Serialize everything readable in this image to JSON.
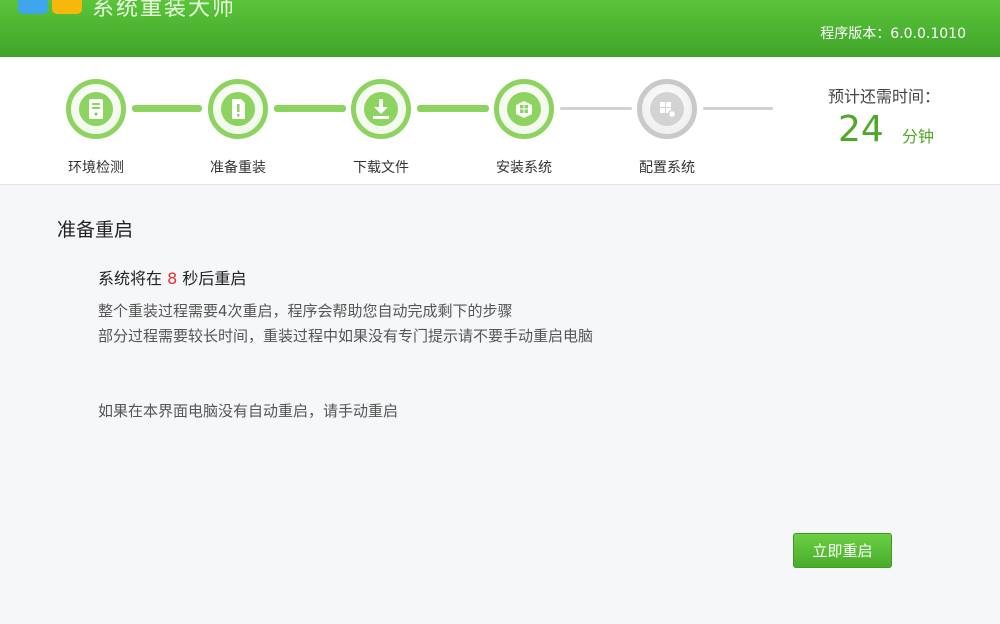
{
  "header": {
    "app_title": "系统重装大师",
    "version": "程序版本：6.0.0.1010",
    "brand_color": "#4cb530"
  },
  "steps": [
    {
      "label": "环境检测",
      "state": "done",
      "icon": "computer-icon"
    },
    {
      "label": "准备重装",
      "state": "done",
      "icon": "document-alert-icon"
    },
    {
      "label": "下载文件",
      "state": "done",
      "icon": "download-icon"
    },
    {
      "label": "安装系统",
      "state": "done",
      "icon": "windows-box-icon"
    },
    {
      "label": "配置系统",
      "state": "pending",
      "icon": "windows-gear-icon"
    }
  ],
  "eta": {
    "label": "预计还需时间：",
    "value": "24",
    "unit": "分钟"
  },
  "main": {
    "section_title": "准备重启",
    "countdown_prefix": "系统将在",
    "countdown_seconds": "8",
    "countdown_suffix": "秒后重启",
    "desc_line1": "整个重装过程需要4次重启，程序会帮助您自动完成剩下的步骤",
    "desc_line2": "部分过程需要较长时间，重装过程中如果没有专门提示请不要手动重启电脑",
    "manual_hint": "如果在本界面电脑没有自动重启，请手动重启"
  },
  "actions": {
    "restart_now": "立即重启"
  }
}
